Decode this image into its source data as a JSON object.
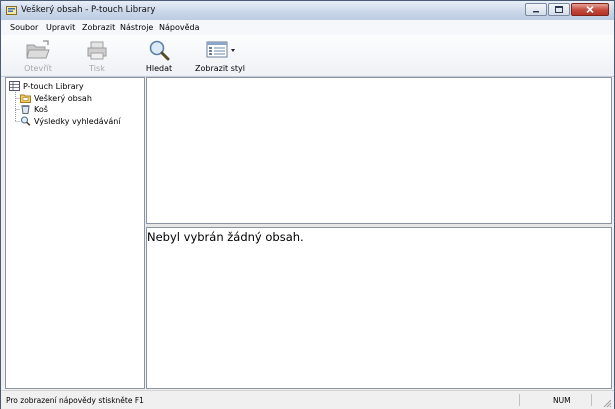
{
  "window": {
    "title": "Veškerý obsah - P-touch Library"
  },
  "menu": {
    "items": [
      "Soubor",
      "Upravit",
      "Zobrazit",
      "Nástroje",
      "Nápověda"
    ]
  },
  "toolbar": {
    "open_label": "Otevřít",
    "print_label": "Tisk",
    "search_label": "Hledat",
    "view_style_label": "Zobrazit styl"
  },
  "tree": {
    "root": "P-touch Library",
    "items": [
      "Veškerý obsah",
      "Koš",
      "Výsledky vyhledávání"
    ]
  },
  "content": {
    "empty_message": "Nebyl vybrán žádný obsah."
  },
  "status": {
    "help_text": "Pro zobrazení nápovědy stiskněte F1",
    "num_indicator": "NUM"
  }
}
